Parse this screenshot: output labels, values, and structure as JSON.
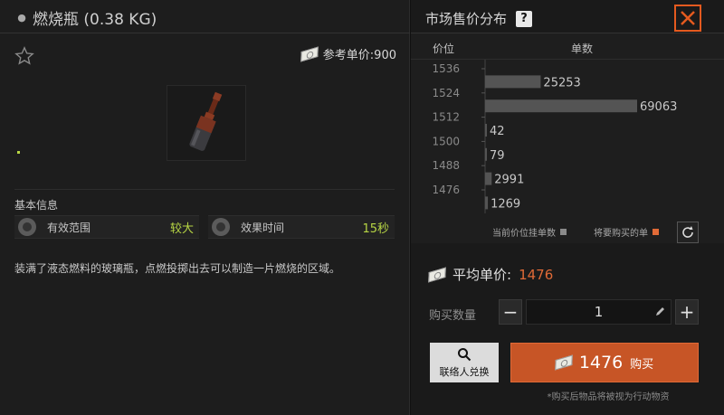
{
  "item": {
    "name_weight": "燃烧瓶 (0.38 KG)",
    "ref_price_label": "参考单价:900",
    "basic_info_label": "基本信息",
    "stats": [
      {
        "label": "有效范围",
        "value": "较大"
      },
      {
        "label": "效果时间",
        "value": "15秒"
      }
    ],
    "description": "装满了液态燃料的玻璃瓶，点燃投掷出去可以制造一片燃烧的区域。"
  },
  "market": {
    "title": "市场售价分布",
    "help_label": "?",
    "col_price": "价位",
    "col_count": "单数",
    "legend_current": "当前价位挂单数",
    "legend_buy": "将要购买的单",
    "avg_label": "平均单价:",
    "avg_value": "1476",
    "qty_label": "购买数量",
    "qty_value": "1",
    "contact_label": "联络人兑换",
    "buy_price": "1476",
    "buy_label": "购买",
    "footnote": "*购买后物品将被视为行动物资"
  },
  "colors": {
    "accent": "#e06a37",
    "positive": "#b7d544",
    "bar": "#545454"
  },
  "chart_data": {
    "type": "bar",
    "orientation": "horizontal",
    "categories": [
      "1536",
      "1524",
      "1512",
      "1500",
      "1488",
      "1476"
    ],
    "values": [
      null,
      25253,
      69063,
      42,
      79,
      2991,
      1269
    ],
    "series": [
      {
        "price": "1536",
        "count": null
      },
      {
        "price": "1524",
        "count": 25253
      },
      {
        "price": "1524-1512",
        "count": 69063
      },
      {
        "price": "1512-1500",
        "count": 42
      },
      {
        "price": "1500-1488",
        "count": 79
      },
      {
        "price": "1488-1476",
        "count": 2991
      },
      {
        "price": "1476",
        "count": 1269
      }
    ],
    "rows": [
      {
        "count": 25253
      },
      {
        "count": 69063
      },
      {
        "count": 42
      },
      {
        "count": 79
      },
      {
        "count": 2991
      },
      {
        "count": 1269
      }
    ],
    "tick_labels": [
      "1536",
      "1524",
      "1512",
      "1500",
      "1488",
      "1476"
    ],
    "xlabel": "单数",
    "ylabel": "价位",
    "xlim": [
      0,
      69063
    ]
  }
}
